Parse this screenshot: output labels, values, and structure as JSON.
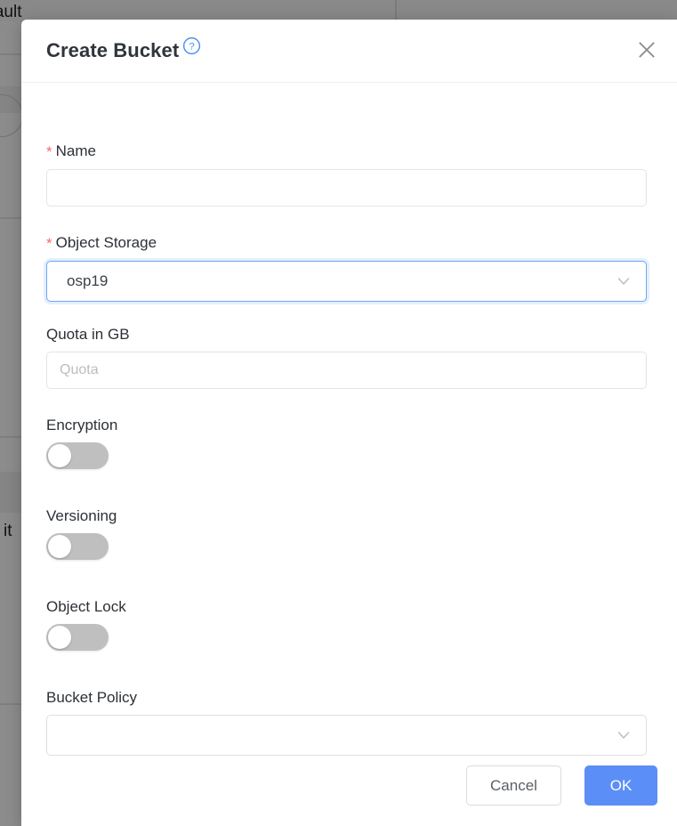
{
  "background": {
    "fragment_top_left": "efault",
    "fragment_mid_left": "it"
  },
  "modal": {
    "title": "Create Bucket",
    "help_icon": "question-circle-icon",
    "close_icon": "close-icon",
    "fields": {
      "name": {
        "label": "Name",
        "required_marker": "*",
        "value": "",
        "placeholder": ""
      },
      "object_storage": {
        "label": "Object Storage",
        "required_marker": "*",
        "value": "osp19",
        "chevron_icon": "chevron-down-icon"
      },
      "quota": {
        "label": "Quota in GB",
        "value": "",
        "placeholder": "Quota"
      },
      "encryption": {
        "label": "Encryption",
        "state": "off"
      },
      "versioning": {
        "label": "Versioning",
        "state": "off"
      },
      "object_lock": {
        "label": "Object Lock",
        "state": "off"
      },
      "bucket_policy": {
        "label": "Bucket Policy",
        "value": "",
        "chevron_icon": "chevron-down-icon"
      }
    },
    "footer": {
      "cancel_label": "Cancel",
      "ok_label": "OK"
    }
  },
  "colors": {
    "primary": "#5b8ef7",
    "required": "#f5696e",
    "help": "#4a90f0",
    "toggle_off": "#bfbfbf",
    "focus_border": "#6ca6f5"
  }
}
